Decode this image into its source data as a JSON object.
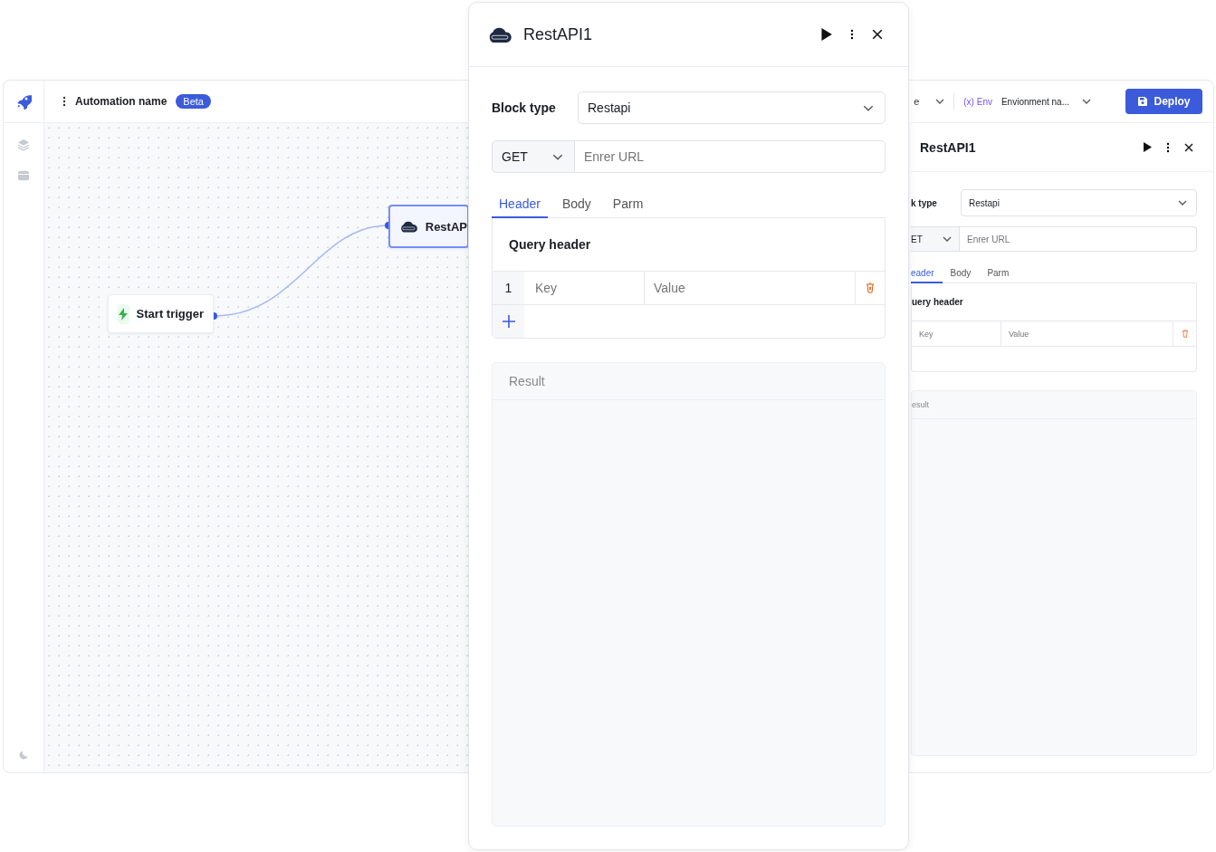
{
  "app": {
    "toolbar": {
      "automation_name": "Automation name",
      "badge": "Beta",
      "partial_select": "e",
      "env_prefix": "(x)",
      "env_label": "Env",
      "environment": "Envionment na...",
      "deploy_button": "Deploy"
    },
    "canvas": {
      "nodes": [
        {
          "kind": "trigger",
          "label": "Start trigger",
          "selected": false
        },
        {
          "kind": "rest",
          "label": "RestAP",
          "selected": true
        }
      ]
    },
    "side_panel": {
      "title": "RestAPI1",
      "block_type_label": "k type",
      "block_type": "Restapi",
      "method": "ET",
      "url_placeholder": "Enrer URL",
      "tabs": [
        {
          "label": "eader",
          "selected": true
        },
        {
          "label": "Body",
          "selected": false
        },
        {
          "label": "Parm",
          "selected": false
        }
      ],
      "section_title": "uery header",
      "key_placeholder": "Key",
      "value_placeholder": "Value",
      "result_label": "esult"
    }
  },
  "panel": {
    "title": "RestAPI1",
    "block_type_label": "Block type",
    "block_type": "Restapi",
    "method": "GET",
    "url_placeholder": "Enrer URL",
    "tabs": [
      {
        "label": "Header",
        "selected": true
      },
      {
        "label": "Body",
        "selected": false
      },
      {
        "label": "Parm",
        "selected": false
      }
    ],
    "section_title": "Query header",
    "rows": [
      {
        "index": "1",
        "key_placeholder": "Key",
        "value_placeholder": "Value"
      }
    ],
    "result_label": "Result"
  }
}
